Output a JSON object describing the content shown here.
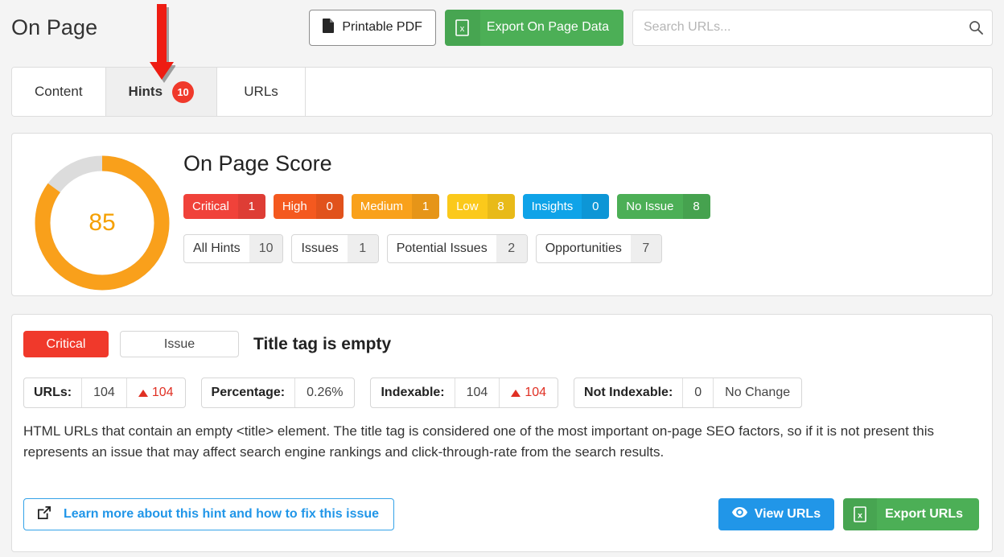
{
  "header": {
    "title": "On Page",
    "buttons": {
      "printable_pdf": "Printable PDF",
      "export_on_page_data": "Export On Page Data"
    },
    "search": {
      "placeholder": "Search URLs...",
      "value": "",
      "icon": "search-icon"
    }
  },
  "tabs": [
    {
      "label": "Content",
      "badge": null,
      "active": false
    },
    {
      "label": "Hints",
      "badge": "10",
      "active": true
    },
    {
      "label": "URLs",
      "badge": null,
      "active": false
    }
  ],
  "score_card": {
    "title": "On Page Score",
    "score": "85",
    "score_percent": 85,
    "severities": [
      {
        "label": "Critical",
        "count": "1",
        "color": "#f0423a"
      },
      {
        "label": "High",
        "count": "0",
        "color": "#f4591f"
      },
      {
        "label": "Medium",
        "count": "1",
        "color": "#f9a11b"
      },
      {
        "label": "Low",
        "count": "8",
        "color": "#fbc91b"
      },
      {
        "label": "Insights",
        "count": "0",
        "color": "#0fa3e8"
      },
      {
        "label": "No Issue",
        "count": "8",
        "color": "#4caf56"
      }
    ],
    "filters": [
      {
        "label": "All Hints",
        "count": "10"
      },
      {
        "label": "Issues",
        "count": "1"
      },
      {
        "label": "Potential Issues",
        "count": "2"
      },
      {
        "label": "Opportunities",
        "count": "7"
      }
    ]
  },
  "hint": {
    "severity": "Critical",
    "severity_color": "#f0392b",
    "type": "Issue",
    "title": "Title tag is empty",
    "metrics": [
      {
        "label": "URLs:",
        "value": "104",
        "delta": "104",
        "delta_dir": "up"
      },
      {
        "label": "Percentage:",
        "value": "0.26%",
        "delta": null,
        "delta_dir": "none"
      },
      {
        "label": "Indexable:",
        "value": "104",
        "delta": "104",
        "delta_dir": "up"
      },
      {
        "label": "Not Indexable:",
        "value": "0",
        "delta": "No Change",
        "delta_dir": "none"
      }
    ],
    "description": "HTML URLs that contain an empty <title> element. The title tag is considered one of the most important on-page SEO factors, so if it is not present this represents an issue that may affect search engine rankings and click-through-rate from the search results.",
    "learn_more": "Learn more about this hint and how to fix this issue",
    "view_urls": "View URLs",
    "export_urls": "Export URLs"
  },
  "annotation": {
    "arrow": "down-arrow-pointing-to-hints-tab",
    "color": "#ee1c12"
  }
}
